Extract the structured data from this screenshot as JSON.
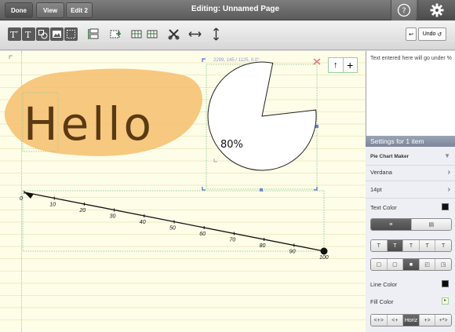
{
  "topbar": {
    "done_label": "Done",
    "view_label": "View",
    "edit_label": "Edit 2",
    "title": "Editing: Unnamed Page"
  },
  "toolbar": {
    "tools": [
      "text-tool-icon",
      "text-icon",
      "shape-tool-icon",
      "picture-tool-icon",
      "dotted-box-icon",
      "align-icon",
      "insert-icon",
      "table-icon",
      "resize-icon",
      "scissors-icon",
      "horizontal-arrow-icon",
      "vertical-arrow-icon"
    ],
    "undo_label": "Undo"
  },
  "canvas": {
    "hello_text": "Hello",
    "selection_readout": "2299, 145 / 1125, 0.0°",
    "pie_percent_label": "80%",
    "pie_percent": 80,
    "number_line": {
      "start": 0,
      "end": 100,
      "tick_labels": [
        "0",
        "10",
        "20",
        "30",
        "40",
        "50",
        "60",
        "70",
        "80",
        "90",
        "100"
      ]
    }
  },
  "panel": {
    "note": "Text entered here will go under %",
    "settings_title": "Settings for 1 item",
    "maker_label": "Pie Chart Maker",
    "font_label": "Verdana",
    "size_label": "14pt",
    "text_color_label": "Text Color",
    "text_color": "#111111",
    "line_color_label": "Line Color",
    "line_color": "#0a0a0a",
    "fill_color_label": "Fill Color",
    "arrow_segments": [
      "<+>",
      "<+",
      "Horiz",
      "+>",
      "+*>"
    ],
    "selected_arrow_segment": "Horiz"
  },
  "colors": {
    "hello_highlight": "#f6c273",
    "hello_ink": "#5a3a14",
    "selection_green": "#7fbf7f",
    "handle_blue": "#6a7fd6"
  }
}
